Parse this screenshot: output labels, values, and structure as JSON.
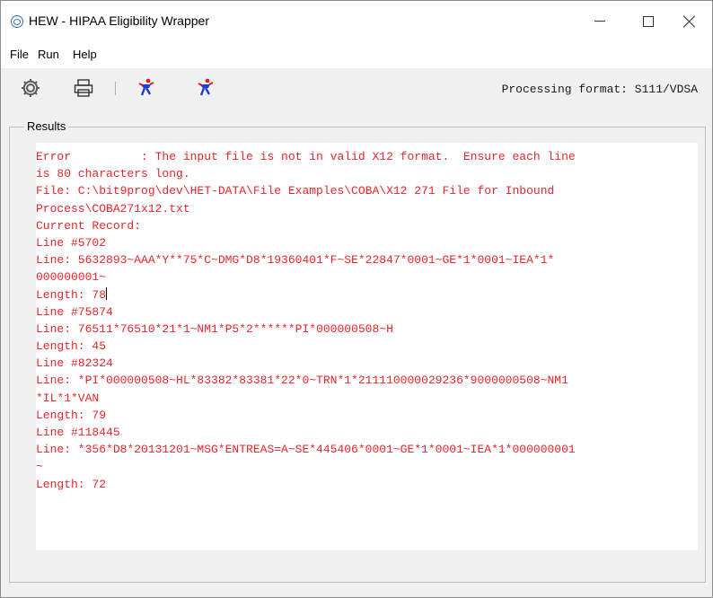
{
  "window": {
    "title": "HEW - HIPAA Eligibility Wrapper",
    "controls": {
      "minimize": "minimize",
      "maximize": "maximize",
      "close": "close"
    }
  },
  "menu": {
    "items": [
      {
        "label": "File"
      },
      {
        "label": "Run"
      },
      {
        "label": "Help"
      }
    ]
  },
  "toolbar": {
    "buttons": [
      {
        "icon": "gear-icon"
      },
      {
        "icon": "printer-icon"
      },
      {
        "icon": "runner-icon"
      },
      {
        "icon": "runner-stop-icon"
      }
    ],
    "processing_format": "Processing format: S111/VDSA"
  },
  "results": {
    "group_label": "Results",
    "lines": [
      "Error          : The input file is not in valid X12 format.  Ensure each line",
      "is 80 characters long.",
      "File: C:\\bit9prog\\dev\\HET-DATA\\File Examples\\COBA\\X12 271 File for Inbound",
      "Process\\COBA271x12.txt",
      "Current Record:",
      "Line #5702",
      "Line: 5632893~AAA*Y**75*C~DMG*D8*19360401*F~SE*22847*0001~GE*1*0001~IEA*1*",
      "000000001~",
      "Length: 78",
      "Line #75874",
      "Line: 76511*76510*21*1~NM1*P5*2******PI*000000508~H",
      "Length: 45",
      "Line #82324",
      "Line: *PI*000000508~HL*83382*83381*22*0~TRN*1*211110000029236*9000000508~NM1",
      "*IL*1*VAN",
      "Length: 79",
      "Line #118445",
      "Line: *356*D8*20131201~MSG*ENTREAS=A~SE*445406*0001~GE*1*0001~IEA*1*000000001",
      "~",
      "Length: 72"
    ],
    "text_color": "#e8262b"
  },
  "colors": {
    "titlebar_bg": "#ffffff",
    "window_bg": "#f0f0f0",
    "icon_blue": "#1a3fd1",
    "icon_red": "#e01b1b"
  }
}
